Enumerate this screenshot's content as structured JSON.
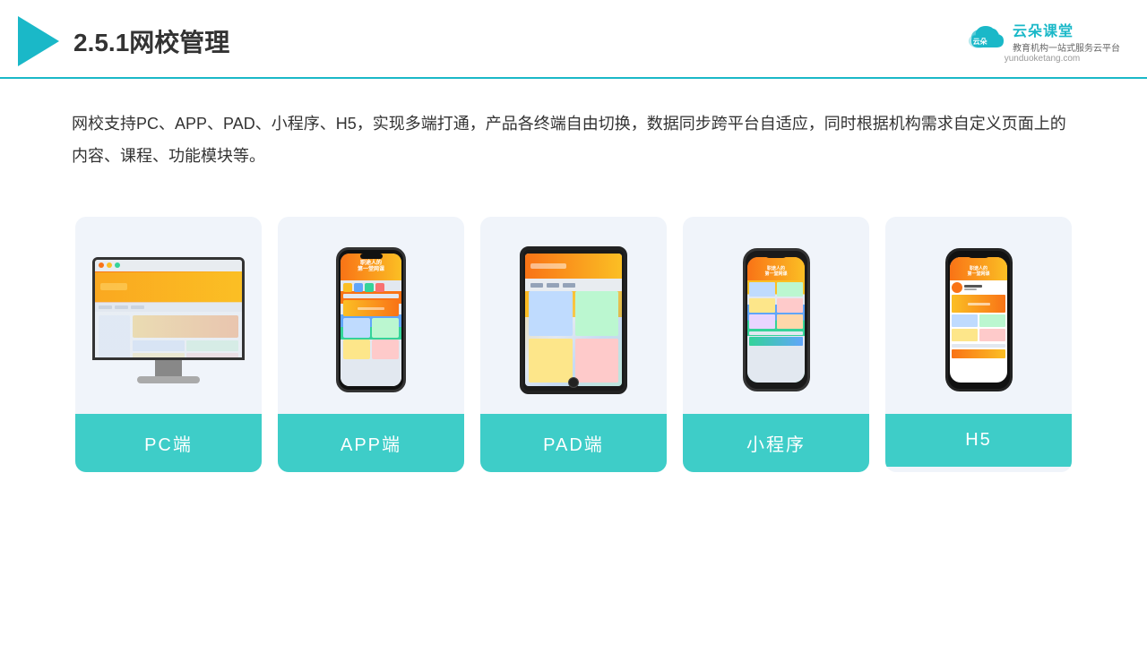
{
  "header": {
    "title": "2.5.1网校管理",
    "brand": {
      "name": "云朵课堂",
      "url": "yunduoketang.com",
      "slogan": "教育机构一站式服务云平台"
    }
  },
  "description": "网校支持PC、APP、PAD、小程序、H5，实现多端打通，产品各终端自由切换，数据同步跨平台自适应，同时根据机构需求自定义页面上的内容、课程、功能模块等。",
  "cards": [
    {
      "id": "pc",
      "label": "PC端",
      "device": "pc"
    },
    {
      "id": "app",
      "label": "APP端",
      "device": "phone-app"
    },
    {
      "id": "pad",
      "label": "PAD端",
      "device": "tablet"
    },
    {
      "id": "miniapp",
      "label": "小程序",
      "device": "phone"
    },
    {
      "id": "h5",
      "label": "H5",
      "device": "phone"
    }
  ]
}
